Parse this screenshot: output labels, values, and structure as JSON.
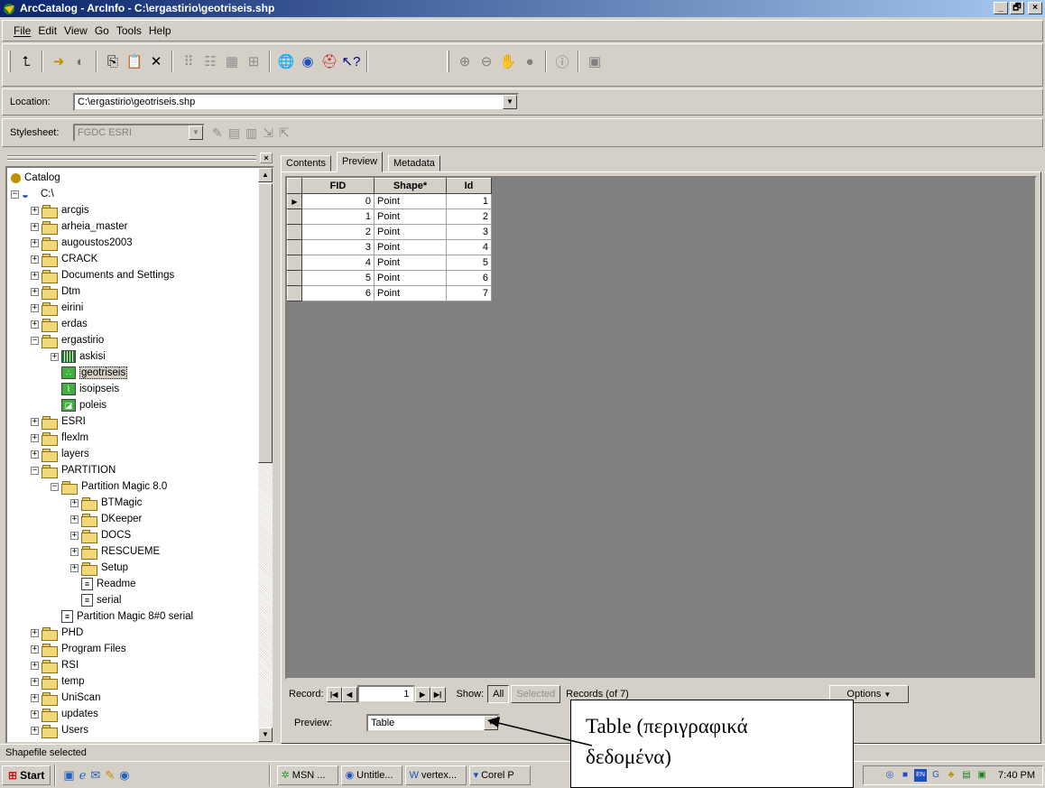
{
  "window": {
    "title": "ArcCatalog - ArcInfo - C:\\ergastirio\\geotriseis.shp",
    "min": "_",
    "max": "🗗",
    "close": "×"
  },
  "menu": [
    "File",
    "Edit",
    "View",
    "Go",
    "Tools",
    "Help"
  ],
  "location": {
    "label": "Location:",
    "value": "C:\\ergastirio\\geotriseis.shp"
  },
  "stylesheet": {
    "label": "Stylesheet:",
    "value": "FGDC ESRI"
  },
  "tree": {
    "nodes": [
      {
        "label": "Catalog",
        "level": 0,
        "pm": "",
        "icon": "catalog"
      },
      {
        "label": "C:\\",
        "level": 0,
        "pm": "−",
        "icon": "drive"
      },
      {
        "label": "arcgis",
        "level": 1,
        "pm": "+",
        "icon": "folder"
      },
      {
        "label": "arheia_master",
        "level": 1,
        "pm": "+",
        "icon": "folder"
      },
      {
        "label": "augoustos2003",
        "level": 1,
        "pm": "+",
        "icon": "folder"
      },
      {
        "label": "CRACK",
        "level": 1,
        "pm": "+",
        "icon": "folder"
      },
      {
        "label": "Documents and Settings",
        "level": 1,
        "pm": "+",
        "icon": "folder"
      },
      {
        "label": "Dtm",
        "level": 1,
        "pm": "+",
        "icon": "folder"
      },
      {
        "label": "eirini",
        "level": 1,
        "pm": "+",
        "icon": "folder"
      },
      {
        "label": "erdas",
        "level": 1,
        "pm": "+",
        "icon": "folder"
      },
      {
        "label": "ergastirio",
        "level": 1,
        "pm": "−",
        "icon": "folder"
      },
      {
        "label": "askisi",
        "level": 2,
        "pm": "+",
        "icon": "grid"
      },
      {
        "label": "geotriseis",
        "level": 2,
        "pm": "",
        "icon": "point",
        "selected": true
      },
      {
        "label": "isoipseis",
        "level": 2,
        "pm": "",
        "icon": "line"
      },
      {
        "label": "poleis",
        "level": 2,
        "pm": "",
        "icon": "poly"
      },
      {
        "label": "ESRI",
        "level": 1,
        "pm": "+",
        "icon": "folder"
      },
      {
        "label": "flexlm",
        "level": 1,
        "pm": "+",
        "icon": "folder"
      },
      {
        "label": "layers",
        "level": 1,
        "pm": "+",
        "icon": "folder"
      },
      {
        "label": "PARTITION",
        "level": 1,
        "pm": "−",
        "icon": "folder"
      },
      {
        "label": "Partition Magic 8.0",
        "level": 2,
        "pm": "−",
        "icon": "folder"
      },
      {
        "label": "BTMagic",
        "level": 3,
        "pm": "+",
        "icon": "folder"
      },
      {
        "label": "DKeeper",
        "level": 3,
        "pm": "+",
        "icon": "folder"
      },
      {
        "label": "DOCS",
        "level": 3,
        "pm": "+",
        "icon": "folder"
      },
      {
        "label": "RESCUEME",
        "level": 3,
        "pm": "+",
        "icon": "folder"
      },
      {
        "label": "Setup",
        "level": 3,
        "pm": "+",
        "icon": "folder"
      },
      {
        "label": "Readme",
        "level": 3,
        "pm": "",
        "icon": "file"
      },
      {
        "label": "serial",
        "level": 3,
        "pm": "",
        "icon": "file"
      },
      {
        "label": "Partition Magic 8#0 serial",
        "level": 2,
        "pm": "",
        "icon": "file"
      },
      {
        "label": "PHD",
        "level": 1,
        "pm": "+",
        "icon": "folder"
      },
      {
        "label": "Program Files",
        "level": 1,
        "pm": "+",
        "icon": "folder"
      },
      {
        "label": "RSI",
        "level": 1,
        "pm": "+",
        "icon": "folder"
      },
      {
        "label": "temp",
        "level": 1,
        "pm": "+",
        "icon": "folder"
      },
      {
        "label": "UniScan",
        "level": 1,
        "pm": "+",
        "icon": "folder"
      },
      {
        "label": "updates",
        "level": 1,
        "pm": "+",
        "icon": "folder"
      },
      {
        "label": "Users",
        "level": 1,
        "pm": "+",
        "icon": "folder"
      }
    ]
  },
  "tabs": [
    "Contents",
    "Preview",
    "Metadata"
  ],
  "table": {
    "columns": [
      "FID",
      "Shape*",
      "Id"
    ],
    "rows": [
      [
        "0",
        "Point",
        "1"
      ],
      [
        "1",
        "Point",
        "2"
      ],
      [
        "2",
        "Point",
        "3"
      ],
      [
        "3",
        "Point",
        "4"
      ],
      [
        "4",
        "Point",
        "5"
      ],
      [
        "5",
        "Point",
        "6"
      ],
      [
        "6",
        "Point",
        "7"
      ]
    ]
  },
  "recordbar": {
    "label": "Record:",
    "value": "1",
    "show": "Show:",
    "all": "All",
    "selected": "Selected",
    "records": "Records (of 7)",
    "options": "Options"
  },
  "preview": {
    "label": "Preview:",
    "value": "Table"
  },
  "status": "Shapefile selected",
  "taskbar": {
    "start": "Start",
    "buttons": [
      "MSN ...",
      "Untitle...",
      "vertex...",
      "Corel P"
    ],
    "clock": "7:40 PM"
  },
  "callout": {
    "line1": "Table (περιγραφικά",
    "line2": "δεδομένα)"
  }
}
